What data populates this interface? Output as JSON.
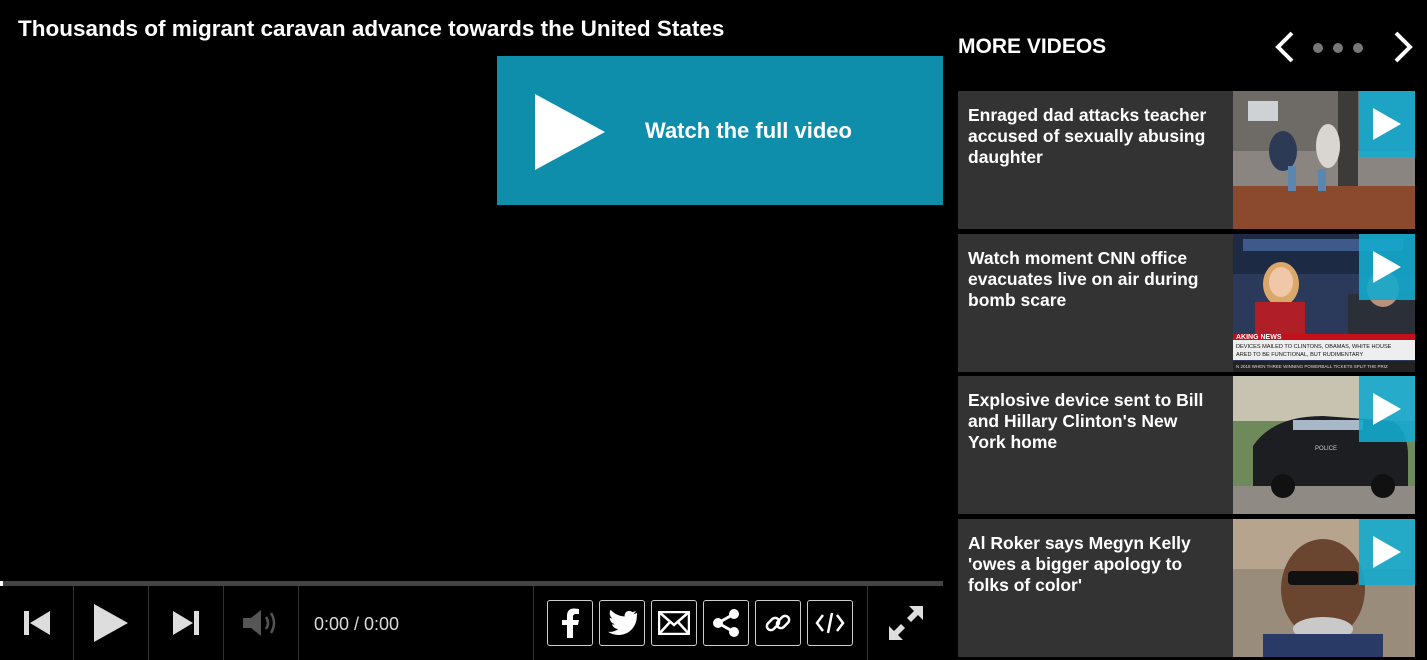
{
  "player": {
    "title": "Thousands of migrant caravan advance towards the United States",
    "cta_label": "Watch the full video",
    "time_display": "0:00 / 0:00",
    "progress": 0,
    "accent_color": "#0e8eab",
    "controls": [
      "prev-icon",
      "play-icon",
      "next-icon",
      "volume-icon"
    ],
    "share_buttons": [
      "facebook-icon",
      "twitter-icon",
      "email-icon",
      "share-icon",
      "link-icon",
      "embed-icon"
    ],
    "fullscreen_icon": "fullscreen-icon"
  },
  "sidebar": {
    "heading": "MORE VIDEOS",
    "nav": {
      "prev_icon": "chevron-left-icon",
      "next_icon": "chevron-right-icon",
      "dots": 3
    },
    "items": [
      {
        "title": "Enraged dad attacks teacher accused of sexually abusing daughter"
      },
      {
        "title": "Watch moment CNN office evacuates live on air during bomb scare",
        "thumb_text": {
          "tag": "AKING NEWS",
          "line1": "DEVICES MAILED TO CLINTONS, OBAMAS, WHITE HOUSE",
          "line2": "ARED TO BE FUNCTIONAL, BUT RUDIMENTARY",
          "ticker": "N 2018 WHEN THREE WINNING POWERBALL TICKETS SPLIT THE PRIZ"
        }
      },
      {
        "title": "Explosive device sent to Bill and Hillary Clinton's New York home",
        "thumb_text": {
          "car_label": "POLICE"
        }
      },
      {
        "title": "Al Roker says Megyn Kelly 'owes a bigger apology to folks of color'"
      }
    ]
  }
}
